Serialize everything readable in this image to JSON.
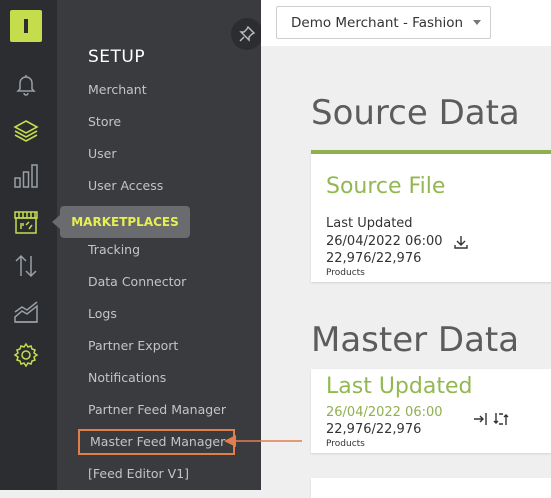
{
  "header": {
    "merchant_select_value": "Demo Merchant - Fashion"
  },
  "sidebar": {
    "icons": [
      "bell-icon",
      "layers-icon",
      "bar-chart-icon",
      "store-icon",
      "transfer-icon",
      "area-chart-icon",
      "gear-icon"
    ],
    "active_icon": "layers-icon"
  },
  "setup": {
    "title": "SETUP",
    "items": [
      "Merchant",
      "Store",
      "User",
      "User Access",
      "Tracking",
      "Data Connector",
      "Logs",
      "Partner Export",
      "Notifications",
      "Partner Feed Manager",
      "Master Feed Manager",
      "[Feed Editor V1]"
    ],
    "highlighted_item": "Master Feed Manager"
  },
  "tooltip": {
    "label": "MARKETPLACES"
  },
  "source": {
    "heading": "Source Data",
    "card_title": "Source File",
    "last_updated_label": "Last Updated",
    "date": "26/04/2022 06:00",
    "count": "22,976/22,976",
    "count_label": "Products"
  },
  "master": {
    "heading": "Master Data",
    "card_title": "Last Updated",
    "date": "26/04/2022 06:00",
    "count": "22,976/22,976",
    "count_label": "Products"
  },
  "colors": {
    "accent_green": "#8fb04f",
    "logo_lime": "#c5dc4d",
    "highlight_orange": "#e17f4c",
    "tooltip_text": "#e6f04e"
  }
}
